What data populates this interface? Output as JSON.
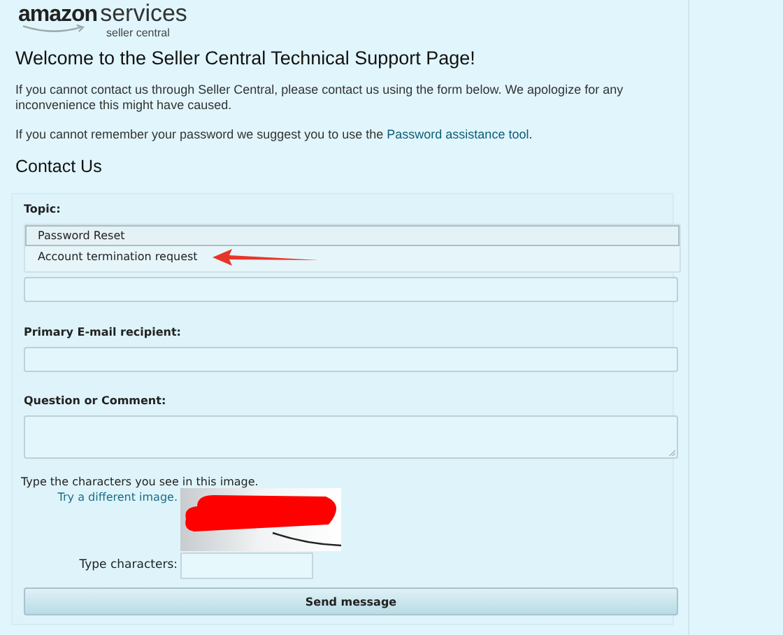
{
  "logo": {
    "brand": "amazon",
    "product": "services",
    "subtitle": "seller central"
  },
  "heading": "Welcome to the Seller Central Technical Support Page!",
  "paragraphs": [
    {
      "text": "If you cannot contact us through Seller Central, please contact us using the form below. We apologize for any inconvenience this might have caused."
    },
    {
      "text": "If you cannot remember your password we suggest you to use the ",
      "link": "Password assistance tool",
      "after": "."
    }
  ],
  "section_title": "Contact Us",
  "form": {
    "topic_label": "Topic:",
    "topic_options": [
      {
        "label": "Password Reset",
        "selected": true,
        "marked": false
      },
      {
        "label": "Account termination request",
        "selected": false,
        "marked": true
      }
    ],
    "fields": [
      {
        "label": "Primary E-mail recipient:",
        "kind": "input"
      },
      {
        "label": "Question or Comment:",
        "kind": "textarea"
      }
    ],
    "captcha": {
      "instruction": "Type the characters you see in this image.",
      "link": "Try a different image.",
      "input_label": "Type characters:"
    },
    "submit": "Send message"
  }
}
